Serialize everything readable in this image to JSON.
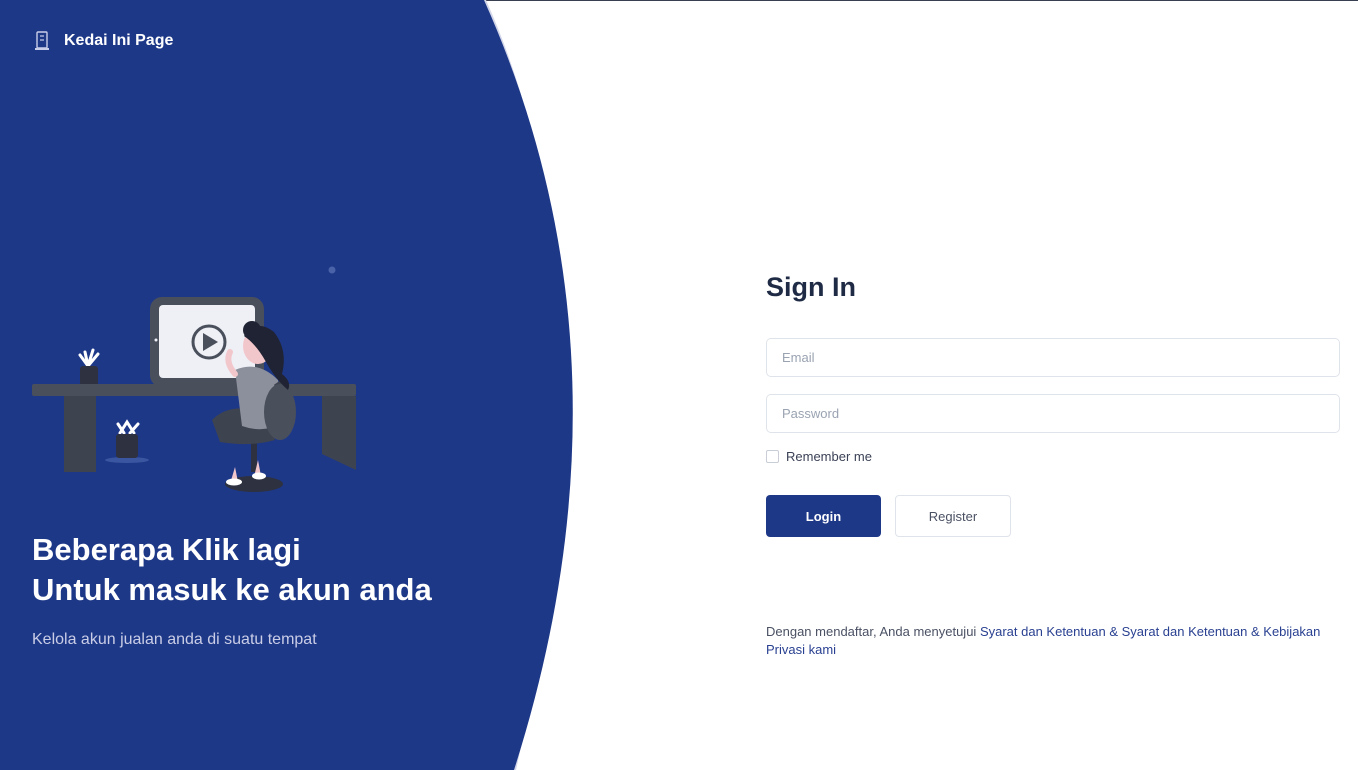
{
  "brand": {
    "name": "Kedai Ini Page",
    "icon": "building-logo-icon"
  },
  "colors": {
    "panel": "#1e3888",
    "accent_curve": "#d2d6e8",
    "primary_button": "#1e3888"
  },
  "hero": {
    "heading_line1": "Beberapa Klik lagi",
    "heading_line2": "Untuk masuk ke akun anda",
    "subtitle": "Kelola akun jualan anda di suatu tempat"
  },
  "signin": {
    "title": "Sign In",
    "email_placeholder": "Email",
    "password_placeholder": "Password",
    "remember_label": "Remember me",
    "login_label": "Login",
    "register_label": "Register"
  },
  "terms": {
    "prefix": "Dengan mendaftar, Anda menyetujui ",
    "link1": "Syarat dan Ketentuan",
    "sep1": " & ",
    "link2": "Syarat dan Ketentuan",
    "sep2": " & ",
    "link3": "Kebijakan Privasi kami"
  }
}
